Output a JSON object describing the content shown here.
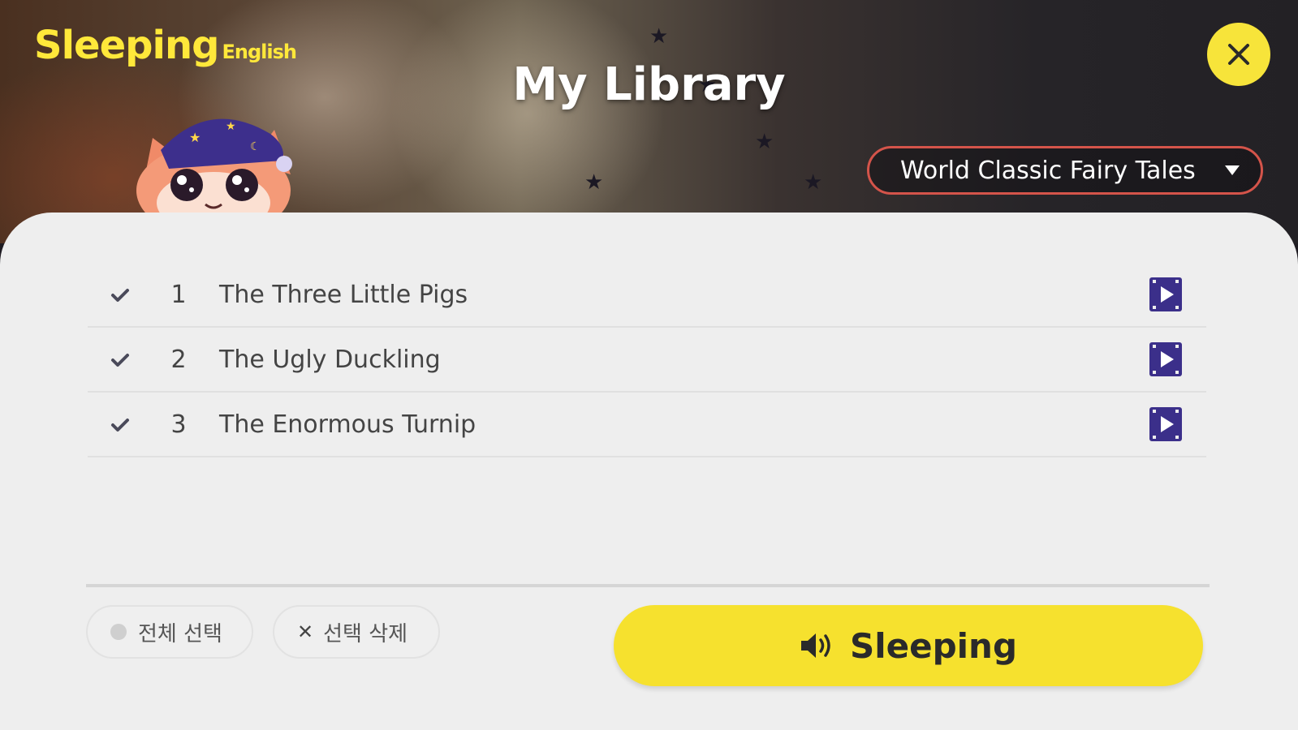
{
  "header": {
    "logo_main": "Sleeping",
    "logo_sub": "English",
    "title": "My Library",
    "category_selected": "World Classic Fairy Tales"
  },
  "stories": [
    {
      "number": "1",
      "title": "The Three Little Pigs"
    },
    {
      "number": "2",
      "title": "The Ugly Duckling"
    },
    {
      "number": "3",
      "title": "The Enormous Turnip"
    }
  ],
  "footer": {
    "select_all_label": "전체 선택",
    "delete_selected_label": "선택 삭제",
    "sleeping_label": "Sleeping"
  },
  "icons": {
    "close": "close-icon",
    "dropdown": "caret-down-icon",
    "check": "check-icon",
    "play": "video-play-icon",
    "speaker": "speaker-icon"
  },
  "colors": {
    "accent_yellow": "#f6e12e",
    "dropdown_border": "#d4544a",
    "play_icon": "#3b2f8a",
    "panel_bg": "#eeeeee"
  }
}
